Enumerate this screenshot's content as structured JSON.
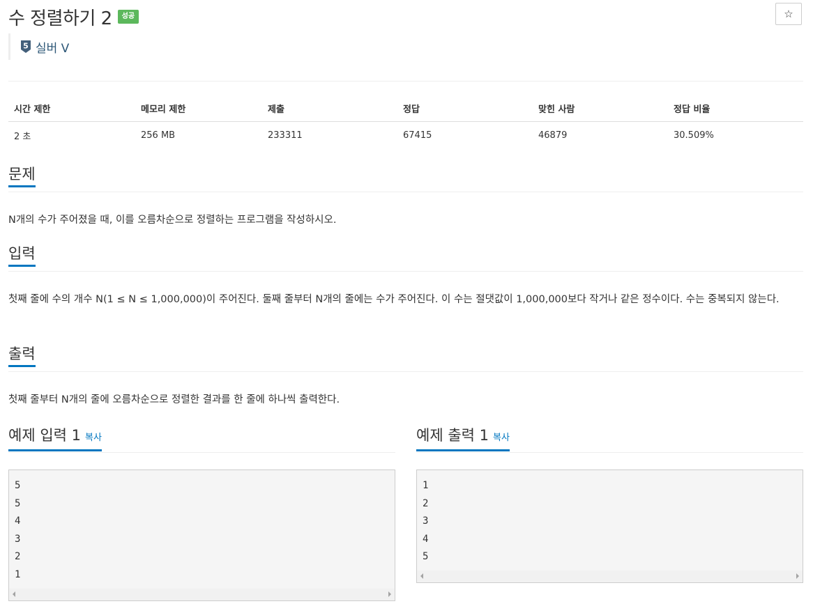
{
  "problem": {
    "title": "수 정렬하기 2",
    "status_badge": "성공",
    "tier_number": "5",
    "tier_label": "실버 V",
    "star_icon": "☆"
  },
  "stats": {
    "headers": [
      "시간 제한",
      "메모리 제한",
      "제출",
      "정답",
      "맞힌 사람",
      "정답 비율"
    ],
    "values": [
      "2 초",
      "256 MB",
      "233311",
      "67415",
      "46879",
      "30.509%"
    ]
  },
  "sections": {
    "problem_heading": "문제",
    "problem_text": "N개의 수가 주어졌을 때, 이를 오름차순으로 정렬하는 프로그램을 작성하시오.",
    "input_heading": "입력",
    "input_text": "첫째 줄에 수의 개수 N(1 ≤ N ≤ 1,000,000)이 주어진다. 둘째 줄부터 N개의 줄에는 수가 주어진다. 이 수는 절댓값이 1,000,000보다 작거나 같은 정수이다. 수는 중복되지 않는다.",
    "output_heading": "출력",
    "output_text": "첫째 줄부터 N개의 줄에 오름차순으로 정렬한 결과를 한 줄에 하나씩 출력한다."
  },
  "samples": {
    "input_title": "예제 입력 1",
    "output_title": "예제 출력 1",
    "copy_label": "복사",
    "input_lines": [
      "5",
      "5",
      "4",
      "3",
      "2",
      "1"
    ],
    "output_lines": [
      "1",
      "2",
      "3",
      "4",
      "5"
    ]
  },
  "colors": {
    "accent": "#0076c0",
    "badge_success": "#5cb85c",
    "tier_silver": "#435f7a"
  }
}
